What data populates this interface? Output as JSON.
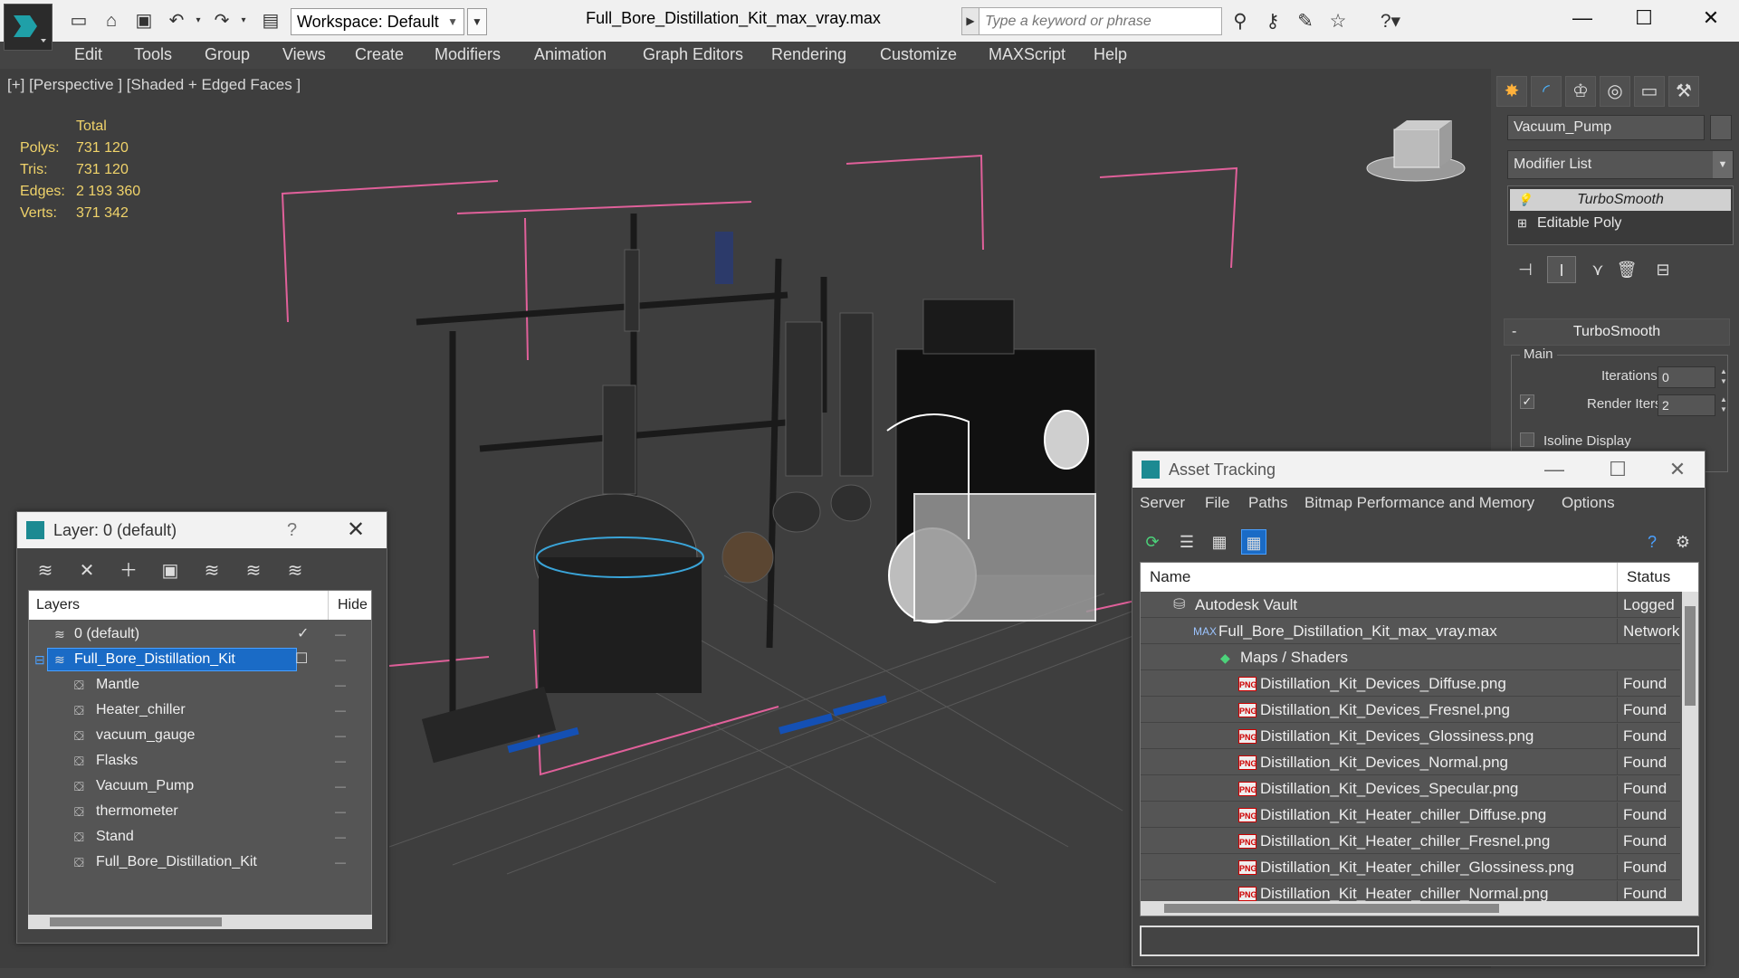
{
  "app": {
    "workspace": "Workspace: Default",
    "window_title": "Full_Bore_Distillation_Kit_max_vray.max",
    "search_placeholder": "Type a keyword or phrase"
  },
  "menu": [
    "Edit",
    "Tools",
    "Group",
    "Views",
    "Create",
    "Modifiers",
    "Animation",
    "Graph Editors",
    "Rendering",
    "Customize",
    "MAXScript",
    "Help"
  ],
  "viewport": {
    "label": "[+] [Perspective ] [Shaded + Edged Faces ]",
    "stats_header": "Total",
    "stats": [
      {
        "key": "Polys:",
        "value": "731 120"
      },
      {
        "key": "Tris:",
        "value": "731 120"
      },
      {
        "key": "Edges:",
        "value": "2 193 360"
      },
      {
        "key": "Verts:",
        "value": "371 342"
      }
    ]
  },
  "command_panel": {
    "object_name": "Vacuum_Pump",
    "modifier_list": "Modifier List",
    "stack": [
      "TurboSmooth",
      "Editable Poly"
    ],
    "rollout_title": "TurboSmooth",
    "group_main": "Main",
    "iterations_label": "Iterations:",
    "iterations_value": "0",
    "render_iters_label": "Render Iters:",
    "render_iters_value": "2",
    "render_iters_checked": true,
    "isoline_label": "Isoline Display"
  },
  "layer_window": {
    "title": "Layer: 0 (default)",
    "help": "?",
    "col_layers": "Layers",
    "col_hide": "Hide",
    "rows": [
      {
        "name": "0 (default)",
        "level": 0,
        "current": true
      },
      {
        "name": "Full_Bore_Distillation_Kit",
        "level": 0,
        "selected": true
      },
      {
        "name": "Mantle",
        "level": 1
      },
      {
        "name": "Heater_chiller",
        "level": 1
      },
      {
        "name": "vacuum_gauge",
        "level": 1
      },
      {
        "name": "Flasks",
        "level": 1
      },
      {
        "name": "Vacuum_Pump",
        "level": 1
      },
      {
        "name": "thermometer",
        "level": 1
      },
      {
        "name": "Stand",
        "level": 1
      },
      {
        "name": "Full_Bore_Distillation_Kit",
        "level": 1
      }
    ]
  },
  "asset_window": {
    "title": "Asset Tracking",
    "menu": [
      "Server",
      "File",
      "Paths",
      "Bitmap Performance and Memory",
      "Options"
    ],
    "col_name": "Name",
    "col_status": "Status",
    "rows": [
      {
        "name": "Autodesk Vault",
        "status": "Logged",
        "level": 1,
        "icon": "vault"
      },
      {
        "name": "Full_Bore_Distillation_Kit_max_vray.max",
        "status": "Network",
        "level": 2,
        "icon": "max"
      },
      {
        "name": "Maps / Shaders",
        "status": "",
        "level": 3,
        "icon": "maps"
      },
      {
        "name": "Distillation_Kit_Devices_Diffuse.png",
        "status": "Found",
        "level": 4,
        "icon": "png"
      },
      {
        "name": "Distillation_Kit_Devices_Fresnel.png",
        "status": "Found",
        "level": 4,
        "icon": "png"
      },
      {
        "name": "Distillation_Kit_Devices_Glossiness.png",
        "status": "Found",
        "level": 4,
        "icon": "png"
      },
      {
        "name": "Distillation_Kit_Devices_Normal.png",
        "status": "Found",
        "level": 4,
        "icon": "png"
      },
      {
        "name": "Distillation_Kit_Devices_Specular.png",
        "status": "Found",
        "level": 4,
        "icon": "png"
      },
      {
        "name": "Distillation_Kit_Heater_chiller_Diffuse.png",
        "status": "Found",
        "level": 4,
        "icon": "png"
      },
      {
        "name": "Distillation_Kit_Heater_chiller_Fresnel.png",
        "status": "Found",
        "level": 4,
        "icon": "png"
      },
      {
        "name": "Distillation_Kit_Heater_chiller_Glossiness.png",
        "status": "Found",
        "level": 4,
        "icon": "png"
      },
      {
        "name": "Distillation_Kit_Heater_chiller_Normal.png",
        "status": "Found",
        "level": 4,
        "icon": "png"
      }
    ]
  },
  "colors": {
    "stats_text": "#f0d36a",
    "selection": "#1a6bc6",
    "bounding_box": "#e0609a"
  }
}
